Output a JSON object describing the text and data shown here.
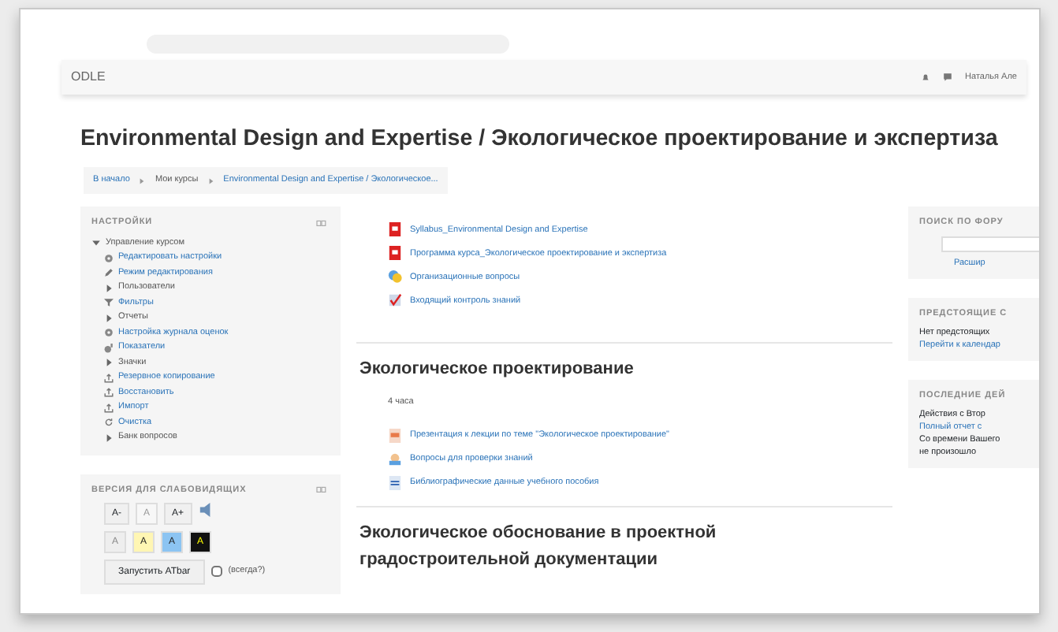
{
  "navbar": {
    "brand": "ODLE",
    "user": "Наталья Але"
  },
  "course_title": "Environmental Design and Expertise / Экологическое проектирование и экспертиза",
  "breadcrumb": [
    {
      "label": "В начало",
      "link": true
    },
    {
      "label": "Мои курсы",
      "link": false
    },
    {
      "label": "Environmental Design and Expertise / Экологическое...",
      "link": true
    }
  ],
  "settings_block": {
    "title": "НАСТРОЙКИ",
    "items": [
      {
        "label": "Управление курсом",
        "kind": "node",
        "expanded": true,
        "children": [
          {
            "label": "Редактировать настройки",
            "kind": "gear"
          },
          {
            "label": "Режим редактирования",
            "kind": "pencil"
          },
          {
            "label": "Пользователи",
            "kind": "node",
            "expanded": false
          },
          {
            "label": "Фильтры",
            "kind": "filter"
          },
          {
            "label": "Отчеты",
            "kind": "node",
            "expanded": false
          },
          {
            "label": "Настройка журнала оценок",
            "kind": "gear"
          },
          {
            "label": "Показатели",
            "kind": "chart"
          },
          {
            "label": "Значки",
            "kind": "node",
            "expanded": false
          },
          {
            "label": "Резервное копирование",
            "kind": "upload"
          },
          {
            "label": "Восстановить",
            "kind": "upload"
          },
          {
            "label": "Импорт",
            "kind": "upload"
          },
          {
            "label": "Очистка",
            "kind": "refresh"
          },
          {
            "label": "Банк вопросов",
            "kind": "node",
            "expanded": false
          }
        ]
      }
    ]
  },
  "accessibility_block": {
    "title": "ВЕРСИЯ ДЛЯ СЛАБОВИДЯЩИХ",
    "size_buttons": [
      {
        "label": "A-",
        "disabled": false
      },
      {
        "label": "A",
        "disabled": true
      },
      {
        "label": "A+",
        "disabled": false
      }
    ],
    "color_buttons": [
      {
        "label": "A",
        "color": "#eeeeee",
        "disabled": true
      },
      {
        "label": "A",
        "color": "#fff6b3",
        "disabled": false
      },
      {
        "label": "A",
        "color": "#8cc4f2",
        "disabled": false
      },
      {
        "label": "A",
        "color": "#111111",
        "disabled": false
      }
    ],
    "atbar_button": "Запустить ATbar",
    "always": {
      "label": "(всегда?)",
      "checked": false
    }
  },
  "sections": [
    {
      "activities": [
        {
          "label": "Syllabus_Environmental Design and Expertise",
          "kind": "pdf"
        },
        {
          "label": "Программа курса_Экологическое проектирование и экспертиза",
          "kind": "pdf"
        },
        {
          "label": "Организационные вопросы",
          "kind": "forum"
        },
        {
          "label": "Входящий контроль знаний",
          "kind": "quiz"
        }
      ]
    },
    {
      "title": "Экологическое проектирование",
      "summary": "4 часа",
      "activities": [
        {
          "label": "Презентация к лекции по теме \"Экологическое проектирование\"",
          "kind": "ppt"
        },
        {
          "label": "Вопросы для проверки знаний",
          "kind": "lesson"
        },
        {
          "label": "Библиографические данные учебного пособия",
          "kind": "doc"
        }
      ]
    },
    {
      "title": "Экологическое обоснование в проектной градостроительной документации"
    }
  ],
  "right_blocks": [
    {
      "title": "ПОИСК ПО ФОРУ",
      "kind": "search",
      "lines": [
        {
          "text": "Расшир",
          "link": true
        }
      ]
    },
    {
      "title": "ПРЕДСТОЯЩИЕ С",
      "kind": "text",
      "lines": [
        {
          "text": "Нет предстоящих",
          "link": false
        },
        {
          "text": "Перейти к календар",
          "link": true
        }
      ]
    },
    {
      "title": "ПОСЛЕДНИЕ ДЕЙ",
      "kind": "text",
      "lines": [
        {
          "text": "Действия с Втор",
          "link": false
        },
        {
          "text": "Полный отчет с",
          "link": true
        },
        {
          "text": "Со времени Вашего",
          "link": false
        },
        {
          "text": "не произошло",
          "link": false
        }
      ]
    }
  ]
}
